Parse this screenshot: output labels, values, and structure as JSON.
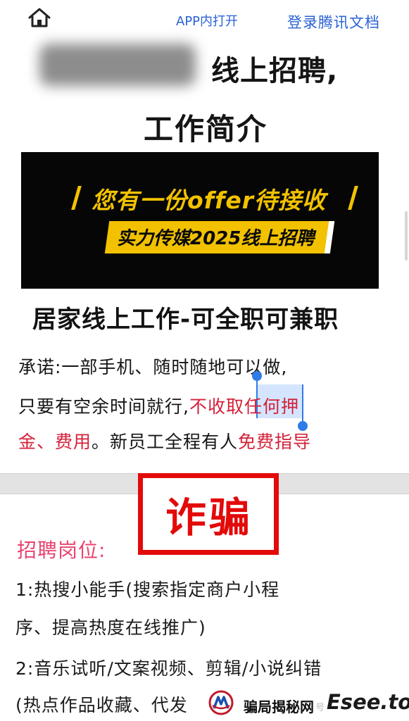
{
  "topbar": {
    "home_icon": "home-icon",
    "app_open": "APP内打开",
    "login": "登录腾讯文档"
  },
  "title": {
    "line1": "线上招聘,",
    "line2": "工作简介"
  },
  "banner": {
    "headline": "您有一份offer待接收",
    "sub": "实力传媒2025线上招聘",
    "bg_color": "#060606",
    "accent_color": "#f2c200"
  },
  "main": {
    "heading": "居家线上工作-可全职可兼职",
    "para_line1": "承诺:一部手机、随时随地可以做,",
    "para_line2_a": "只要有空余时间就行,",
    "para_line2_b": "不收取任何押",
    "para_line3_a": "金、费用",
    "para_line3_b": "。新员工全程有人",
    "para_line3_c": "免费指导",
    "highlight_color": "#d3223a"
  },
  "stamp": {
    "text": "诈骗",
    "color": "#e30a0a"
  },
  "positions": {
    "label": "招聘岗位:",
    "item1_line1": "1:热搜小能手(搜索指定商户小程",
    "item1_line2": "序、提高热度在线推广)",
    "item2_line1": "2:音乐试听/文案视频、剪辑/小说纠错",
    "item2_line2": "(热点作品收藏、代发"
  },
  "watermark": {
    "site_name": "骗局揭秘网",
    "faint": "号",
    "domain": "Esee.top"
  }
}
